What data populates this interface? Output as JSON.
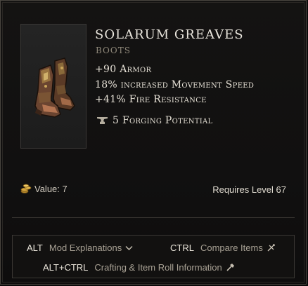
{
  "item": {
    "name": "SOLARUM GREAVES",
    "type": "BOOTS",
    "stats": [
      "+90 Armor",
      "18% increased Movement Speed",
      "+41% Fire Resistance"
    ],
    "forging": "5 Forging Potential",
    "value": "Value: 7",
    "requirement": "Requires Level 67"
  },
  "hints": {
    "mod": {
      "key": "ALT",
      "label": "Mod Explanations"
    },
    "compare": {
      "key": "CTRL",
      "label": "Compare Items"
    },
    "crafting": {
      "key": "ALT+CTRL",
      "label": "Crafting & Item Roll Information"
    }
  },
  "icons": {
    "item_image": "boots-icon",
    "forging": "anvil-icon",
    "value": "gold-coins-icon",
    "mod": "chevron-down-icon",
    "compare": "swords-icon",
    "crafting": "hammer-icon"
  },
  "colors": {
    "title": "#e8e4dc",
    "subtitle": "#8e8779",
    "stat": "#e6e1d6",
    "hint_key": "#ece7dc",
    "hint_desc": "#a8a194"
  }
}
